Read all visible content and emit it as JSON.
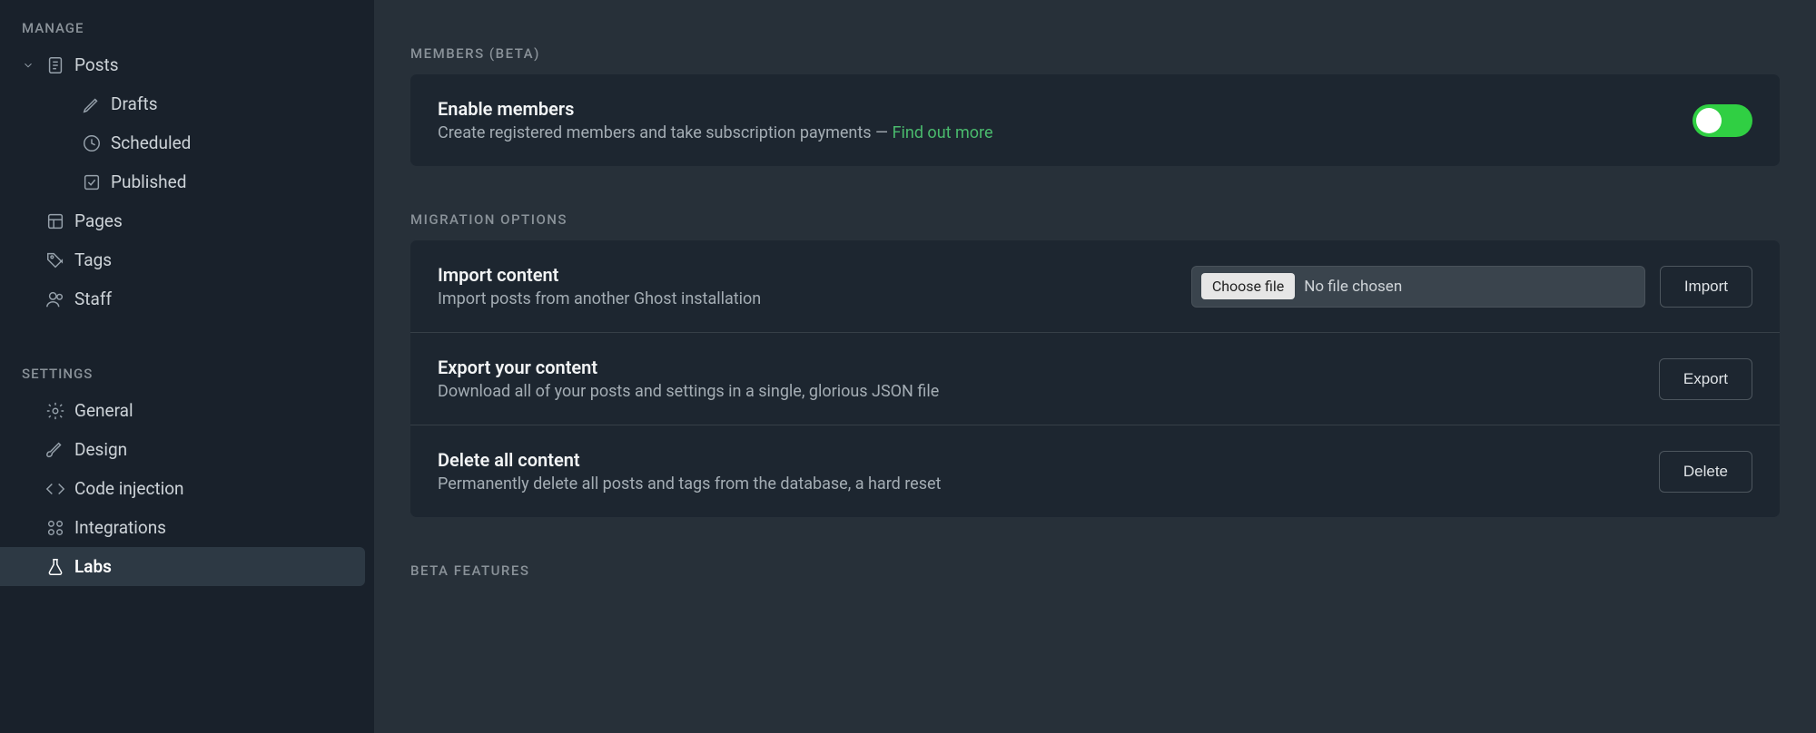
{
  "sidebar": {
    "manage_label": "MANAGE",
    "settings_label": "SETTINGS",
    "posts": {
      "label": "Posts",
      "drafts": "Drafts",
      "scheduled": "Scheduled",
      "published": "Published"
    },
    "pages": "Pages",
    "tags": "Tags",
    "staff": "Staff",
    "general": "General",
    "design": "Design",
    "code_injection": "Code injection",
    "integrations": "Integrations",
    "labs": "Labs"
  },
  "members_section": {
    "title": "MEMBERS (BETA)",
    "enable_title": "Enable members",
    "enable_desc_prefix": "Create registered members and take subscription payments — ",
    "enable_link": "Find out more",
    "toggle_on": true
  },
  "migration_section": {
    "title": "MIGRATION OPTIONS",
    "import": {
      "title": "Import content",
      "desc": "Import posts from another Ghost installation",
      "file_button_label": "Choose file",
      "file_status": "No file chosen",
      "button": "Import"
    },
    "export": {
      "title": "Export your content",
      "desc": "Download all of your posts and settings in a single, glorious JSON file",
      "button": "Export"
    },
    "delete": {
      "title": "Delete all content",
      "desc": "Permanently delete all posts and tags from the database, a hard reset",
      "button": "Delete"
    }
  },
  "beta_section": {
    "title": "BETA FEATURES"
  }
}
